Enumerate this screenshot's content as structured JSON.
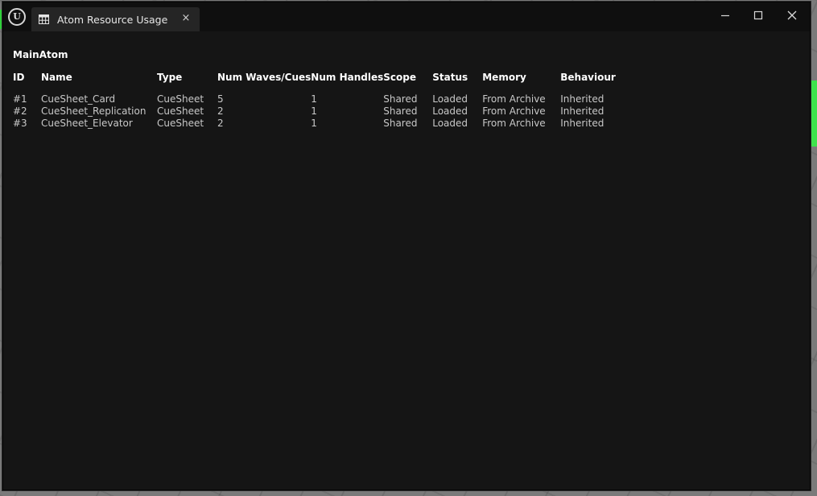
{
  "window": {
    "tab_title": "Atom Resource Usage",
    "tab_icon": "table-icon",
    "app_icon": "unreal-logo-icon",
    "close_tab_glyph": "×"
  },
  "section": {
    "title": "MainAtom"
  },
  "table": {
    "headers": [
      "ID",
      "Name",
      "Type",
      "Num Waves/Cues",
      "Num Handles",
      "Scope",
      "Status",
      "Memory",
      "Behaviour"
    ],
    "rows": [
      [
        "#1",
        "CueSheet_Card",
        "CueSheet",
        "5",
        "1",
        "Shared",
        "Loaded",
        "From Archive",
        "Inherited"
      ],
      [
        "#2",
        "CueSheet_Replication",
        "CueSheet",
        "2",
        "1",
        "Shared",
        "Loaded",
        "From Archive",
        "Inherited"
      ],
      [
        "#3",
        "CueSheet_Elevator",
        "CueSheet",
        "2",
        "1",
        "Shared",
        "Loaded",
        "From Archive",
        "Inherited"
      ]
    ]
  },
  "colors": {
    "window_bg": "#151515",
    "titlebar_bg": "#0f0f0f",
    "tab_bg": "#252525",
    "header_text": "#ffffff",
    "cell_text": "#c8c8c8"
  }
}
